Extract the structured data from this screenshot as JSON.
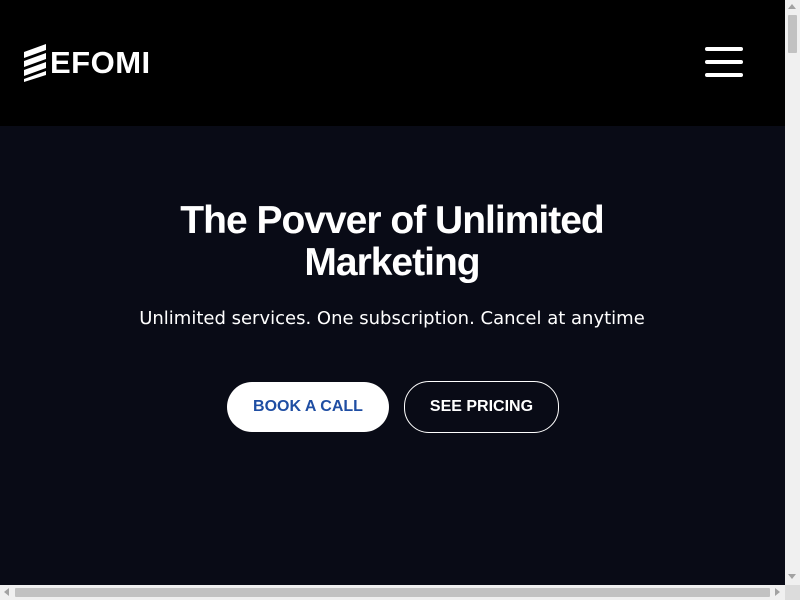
{
  "header": {
    "logo_text": "EFOMI",
    "logo_icon": "stacked-bars-logo-icon",
    "menu_icon": "hamburger-menu-icon"
  },
  "hero": {
    "title_line1": "The Povver of Unlimited",
    "title_line2": "Marketing",
    "subtitle": "Unlimited services. One subscription. Cancel at anytime",
    "primary_cta": "BOOK A CALL",
    "secondary_cta": "SEE PRICING"
  },
  "colors": {
    "header_bg": "#000000",
    "hero_bg": "#090b16",
    "primary_cta_text": "#1f4ea3",
    "text": "#ffffff"
  },
  "scrollbars": {
    "vertical_icon_up": "arrow-up-icon",
    "vertical_icon_down": "arrow-down-icon",
    "horizontal_icon_left": "arrow-left-icon",
    "horizontal_icon_right": "arrow-right-icon"
  }
}
